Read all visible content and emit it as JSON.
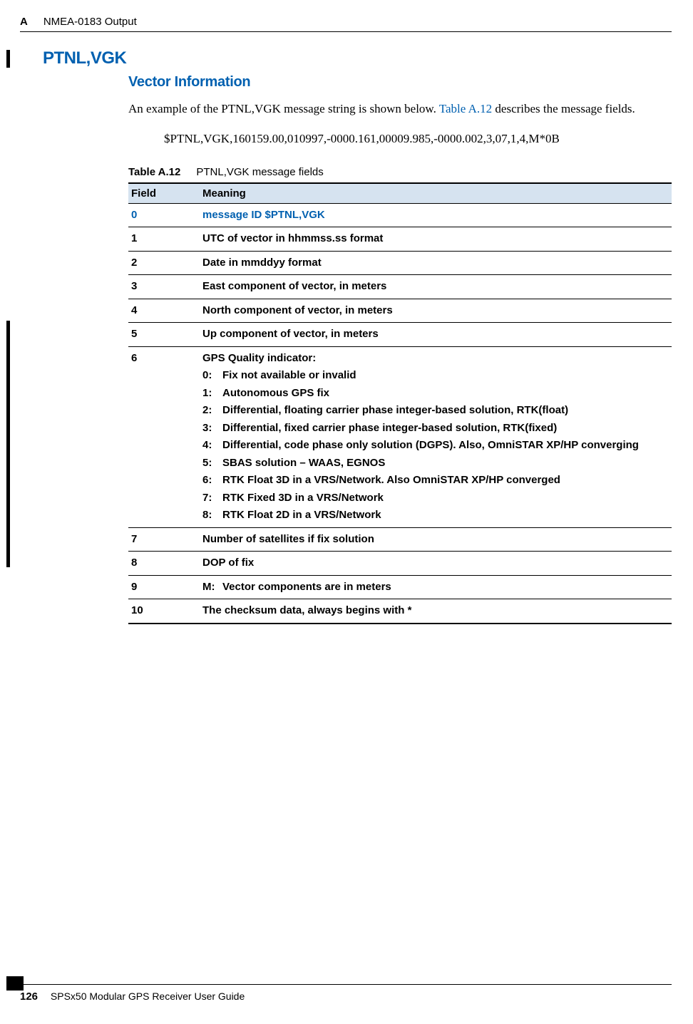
{
  "header": {
    "appendix": "A",
    "title": "NMEA-0183 Output"
  },
  "section": {
    "title": "PTNL,VGK",
    "subtitle": "Vector Information",
    "intro_pre": "An example of the PTNL,VGK message string is shown below. ",
    "intro_link": "Table A.12",
    "intro_post": " describes the message fields.",
    "example": "$PTNL,VGK,160159.00,010997,-0000.161,00009.985,-0000.002,3,07,1,4,M*0B"
  },
  "table": {
    "caption_label": "Table A.12",
    "caption_text": "PTNL,VGK message fields",
    "head_field": "Field",
    "head_meaning": "Meaning",
    "rows": [
      {
        "field": "0",
        "meaning": "message ID $PTNL,VGK",
        "highlight": true
      },
      {
        "field": "1",
        "meaning": "UTC of vector in hhmmss.ss format"
      },
      {
        "field": "2",
        "meaning": "Date in mmddyy format"
      },
      {
        "field": "3",
        "meaning": "East component of vector, in meters"
      },
      {
        "field": "4",
        "meaning": "North component of vector, in meters"
      },
      {
        "field": "5",
        "meaning": "Up component of vector, in meters"
      },
      {
        "field": "6",
        "meaning_label": "GPS Quality indicator:",
        "quality_list": [
          {
            "n": "0:",
            "d": "Fix not available or invalid"
          },
          {
            "n": "1:",
            "d": "Autonomous GPS fix"
          },
          {
            "n": "2:",
            "d": "Differential, floating carrier phase integer-based solution, RTK(float)"
          },
          {
            "n": "3:",
            "d": "Differential, fixed carrier phase integer-based solution, RTK(fixed)"
          },
          {
            "n": "4:",
            "d": "Differential, code phase only solution (DGPS). Also, OmniSTAR XP/HP converging"
          },
          {
            "n": "5:",
            "d": "SBAS solution – WAAS, EGNOS"
          },
          {
            "n": "6:",
            "d": "RTK Float 3D in a VRS/Network. Also OmniSTAR XP/HP converged"
          },
          {
            "n": "7:",
            "d": "RTK Fixed 3D in a VRS/Network"
          },
          {
            "n": "8:",
            "d": "RTK Float 2D in a VRS/Network"
          }
        ]
      },
      {
        "field": "7",
        "meaning": "Number of satellites if fix solution"
      },
      {
        "field": "8",
        "meaning": "DOP of fix"
      },
      {
        "field": "9",
        "m_label": "M:",
        "m_desc": "Vector components are in meters"
      },
      {
        "field": "10",
        "meaning": "The checksum data, always begins with *"
      }
    ]
  },
  "footer": {
    "page": "126",
    "doc": "SPSx50 Modular GPS Receiver User Guide"
  }
}
